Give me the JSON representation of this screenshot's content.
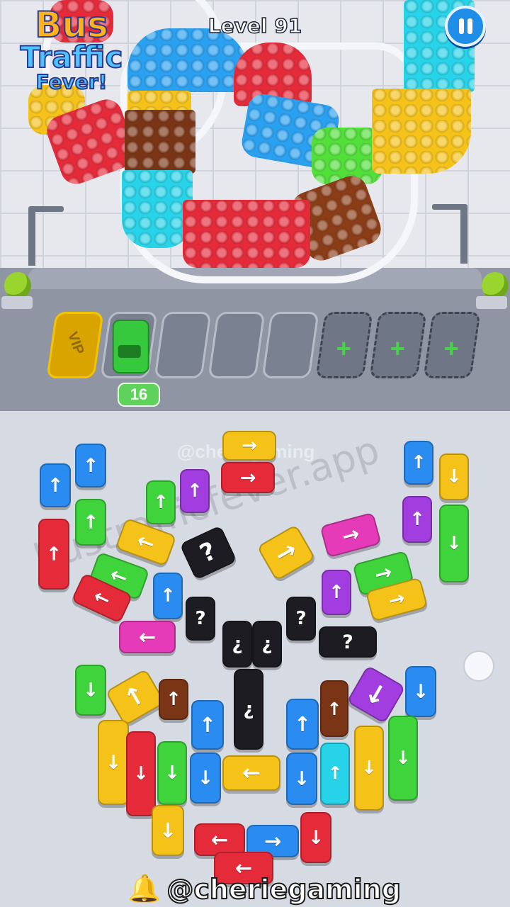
{
  "app": {
    "logo_line1": "Bus",
    "logo_line2": "Traffic",
    "logo_line3": "Fever!",
    "level_label": "Level 91",
    "pause_icon": "pause-icon"
  },
  "parking": {
    "vip_label": "VIP",
    "plus_label": "+",
    "remaining_count": "16"
  },
  "watermarks": {
    "top": "@cheriegaming",
    "diagonal": "bustrafficfever.app"
  },
  "credit": {
    "bell_icon": "bell-icon",
    "handle": "@cheriegaming"
  },
  "colors": {
    "red": "#e52b3a",
    "blue": "#2a8cf0",
    "green": "#3fd43c",
    "yellow": "#f5c21a",
    "purple": "#a23ee0",
    "pink": "#e63bb8",
    "brown": "#7a3516",
    "cyan": "#27d3e8",
    "black": "#1c1c22"
  },
  "arrow_glyphs": {
    "up": "↑",
    "down": "↓",
    "left": "←",
    "right": "→",
    "mystery": "?",
    "mystery_flip": "¿"
  }
}
